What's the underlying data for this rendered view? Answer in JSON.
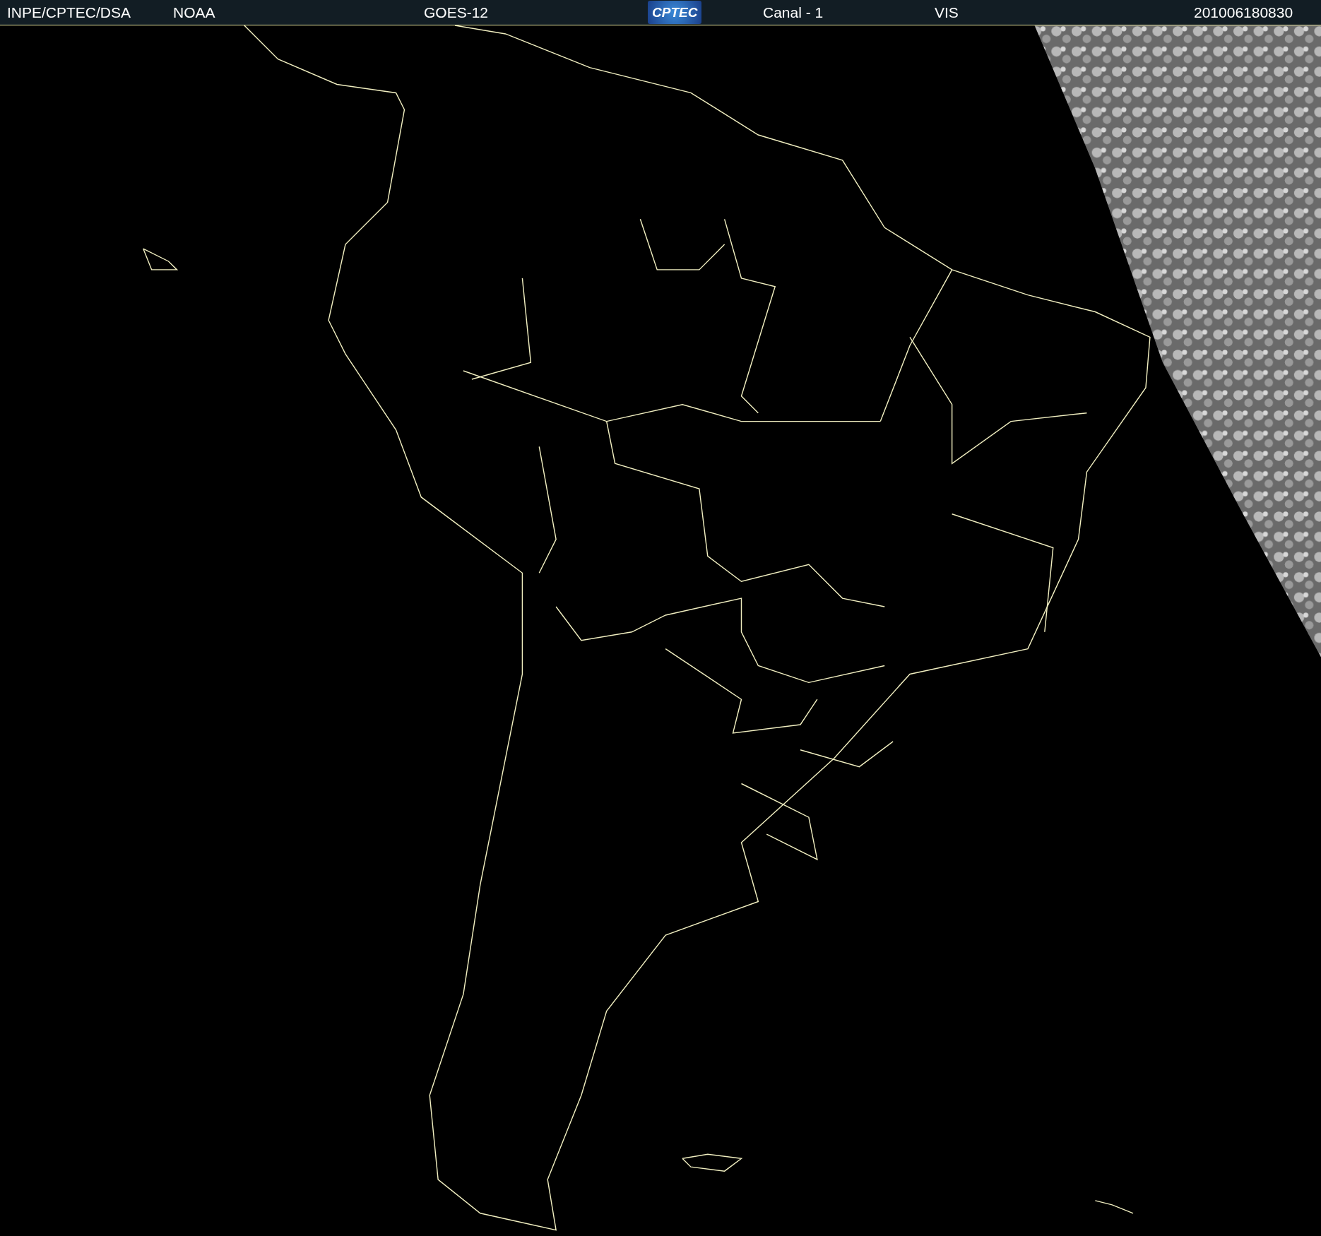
{
  "header": [
    {
      "kind": "text",
      "text": "INPE/CPTEC/DSA"
    },
    {
      "kind": "text",
      "text": "NOAA"
    },
    {
      "kind": "text",
      "text": "GOES-12"
    },
    {
      "kind": "logo",
      "text": "CPTEC"
    },
    {
      "kind": "text",
      "text": "Canal - 1"
    },
    {
      "kind": "text",
      "text": "VIS"
    },
    {
      "kind": "text",
      "text": "201006180830"
    }
  ]
}
